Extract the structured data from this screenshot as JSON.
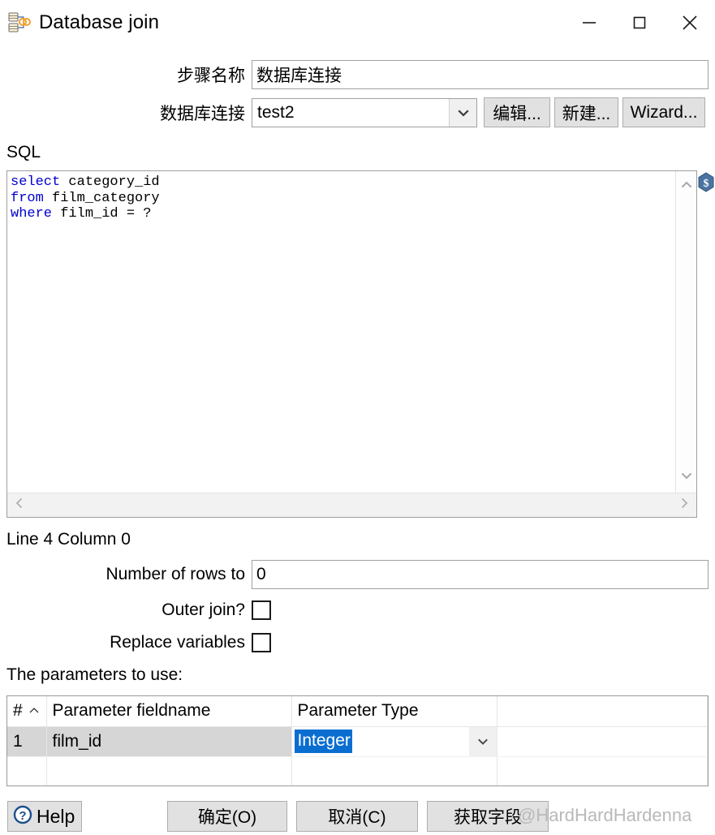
{
  "window": {
    "title": "Database join",
    "icon": "database-join-icon",
    "controls": {
      "minimize": "minimize-icon",
      "maximize": "maximize-icon",
      "close": "close-icon"
    }
  },
  "form": {
    "step_name": {
      "label": "步骤名称",
      "value": "数据库连接"
    },
    "connection": {
      "label": "数据库连接",
      "value": "test2",
      "buttons": [
        {
          "label": "编辑...",
          "name": "edit-connection-button"
        },
        {
          "label": "新建...",
          "name": "new-connection-button"
        },
        {
          "label": "Wizard...",
          "name": "connection-wizard-button"
        }
      ]
    }
  },
  "sql": {
    "label": "SQL",
    "lines": [
      {
        "keyword": "select",
        "rest": " category_id"
      },
      {
        "keyword": "from",
        "rest": " film_category"
      },
      {
        "keyword": "where",
        "rest": " film_id = ?"
      }
    ],
    "variable_icon": "dollar-variable-icon",
    "status": "Line 4 Column 0"
  },
  "options": {
    "rows_limit": {
      "label": "Number of rows to",
      "value": "0"
    },
    "outer_join": {
      "label": "Outer join?",
      "checked": false
    },
    "replace_variables": {
      "label": "Replace variables",
      "checked": false
    }
  },
  "parameters": {
    "label": "The parameters to use:",
    "columns": [
      "#",
      "Parameter fieldname",
      "Parameter Type",
      ""
    ],
    "rows": [
      {
        "num": "1",
        "fieldname": "film_id",
        "type": "Integer",
        "type_selected": true
      },
      {
        "num": "",
        "fieldname": "",
        "type": "",
        "type_selected": false
      }
    ]
  },
  "footer": {
    "help": "Help",
    "ok": "确定(O)",
    "cancel": "取消(C)",
    "get_fields": "获取字段"
  },
  "watermark": "@HardHardHardenna",
  "colors": {
    "sql_keyword": "#0000cc",
    "selection": "#0a6ed1",
    "button_face": "#e1e1e1",
    "row_highlight": "#d6d6d6"
  }
}
